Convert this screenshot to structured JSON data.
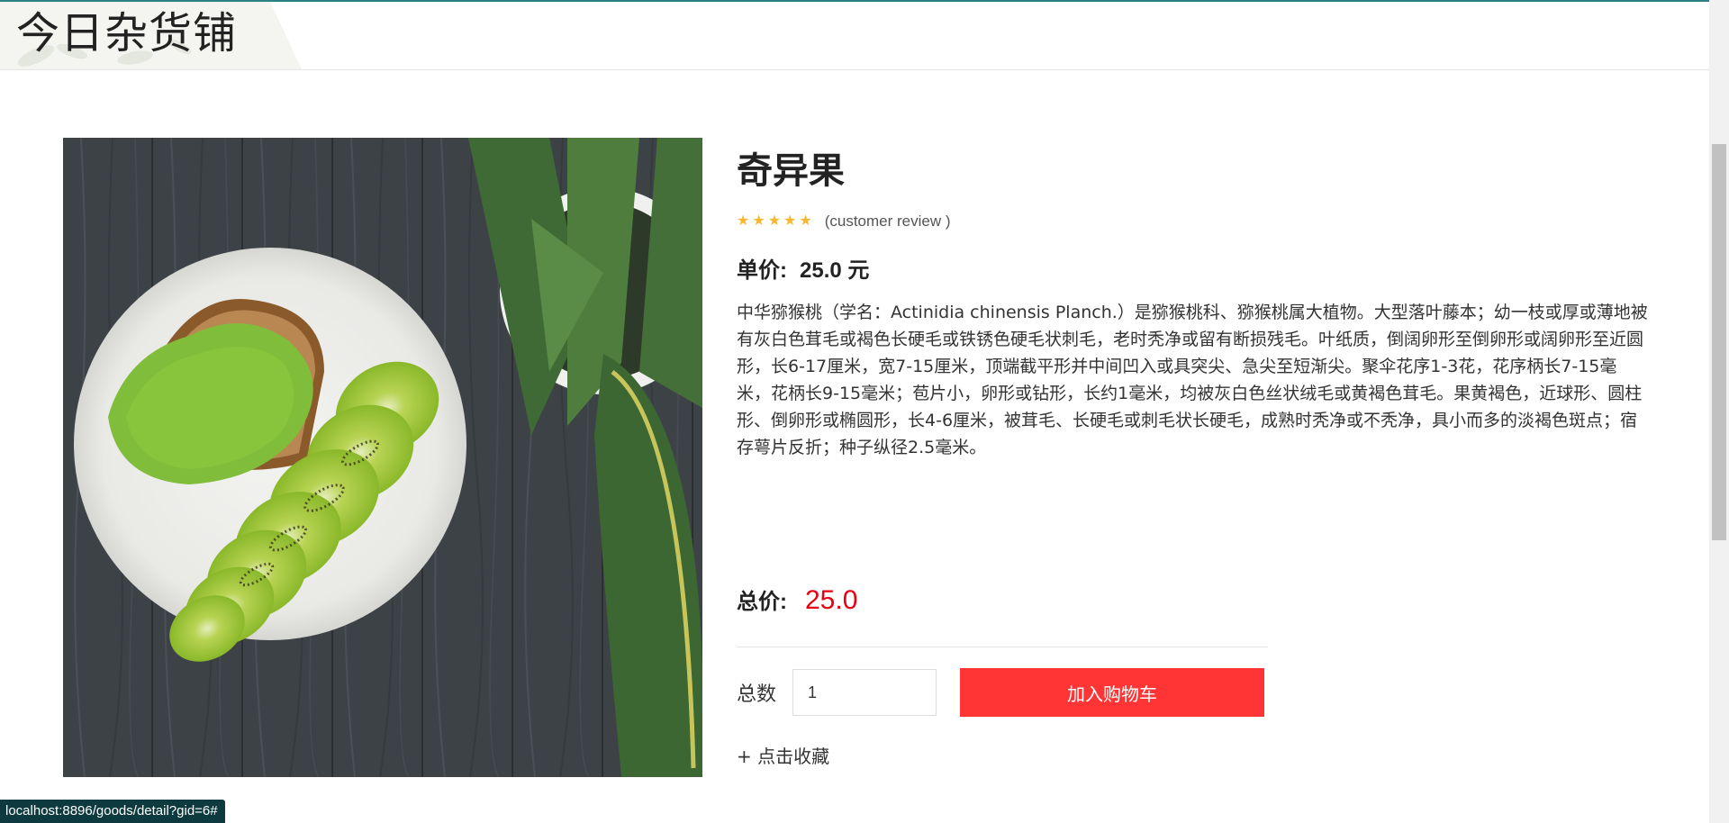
{
  "header": {
    "site_title": "今日杂货铺"
  },
  "product": {
    "name": "奇异果",
    "rating_stars": 5,
    "review_text": "(customer review )",
    "price_label": "单价:",
    "price_value": "25.0 元",
    "description": "中华猕猴桃（学名：Actinidia chinensis Planch.）是猕猴桃科、猕猴桃属大植物。大型落叶藤本；幼一枝或厚或薄地被有灰白色茸毛或褐色长硬毛或铁锈色硬毛状刺毛，老时秃净或留有断损残毛。叶纸质，倒阔卵形至倒卵形或阔卵形至近圆形，长6-17厘米，宽7-15厘米，顶端截平形并中间凹入或具突尖、急尖至短渐尖。聚伞花序1-3花，花序柄长7-15毫米，花柄长9-15毫米；苞片小，卵形或钻形，长约1毫米，均被灰白色丝状绒毛或黄褐色茸毛。果黄褐色，近球形、圆柱形、倒卵形或椭圆形，长4-6厘米，被茸毛、长硬毛或刺毛状长硬毛，成熟时秃净或不秃净，具小而多的淡褐色斑点；宿存萼片反折；种子纵径2.5毫米。"
  },
  "purchase": {
    "total_label": "总价:",
    "total_value": "25.0",
    "quantity_label": "总数",
    "quantity_value": "1",
    "add_to_cart_label": "加入购物车",
    "favorite_label": "+ 点击收藏"
  },
  "status_bar": {
    "url": "localhost:8896/goods/detail?gid=6#"
  },
  "colors": {
    "accent_red": "#fe3534",
    "price_red": "#e60012",
    "star_gold": "#f7b731",
    "status_bar_bg": "#0c3a3f"
  },
  "icons": {
    "star": "star-icon"
  }
}
